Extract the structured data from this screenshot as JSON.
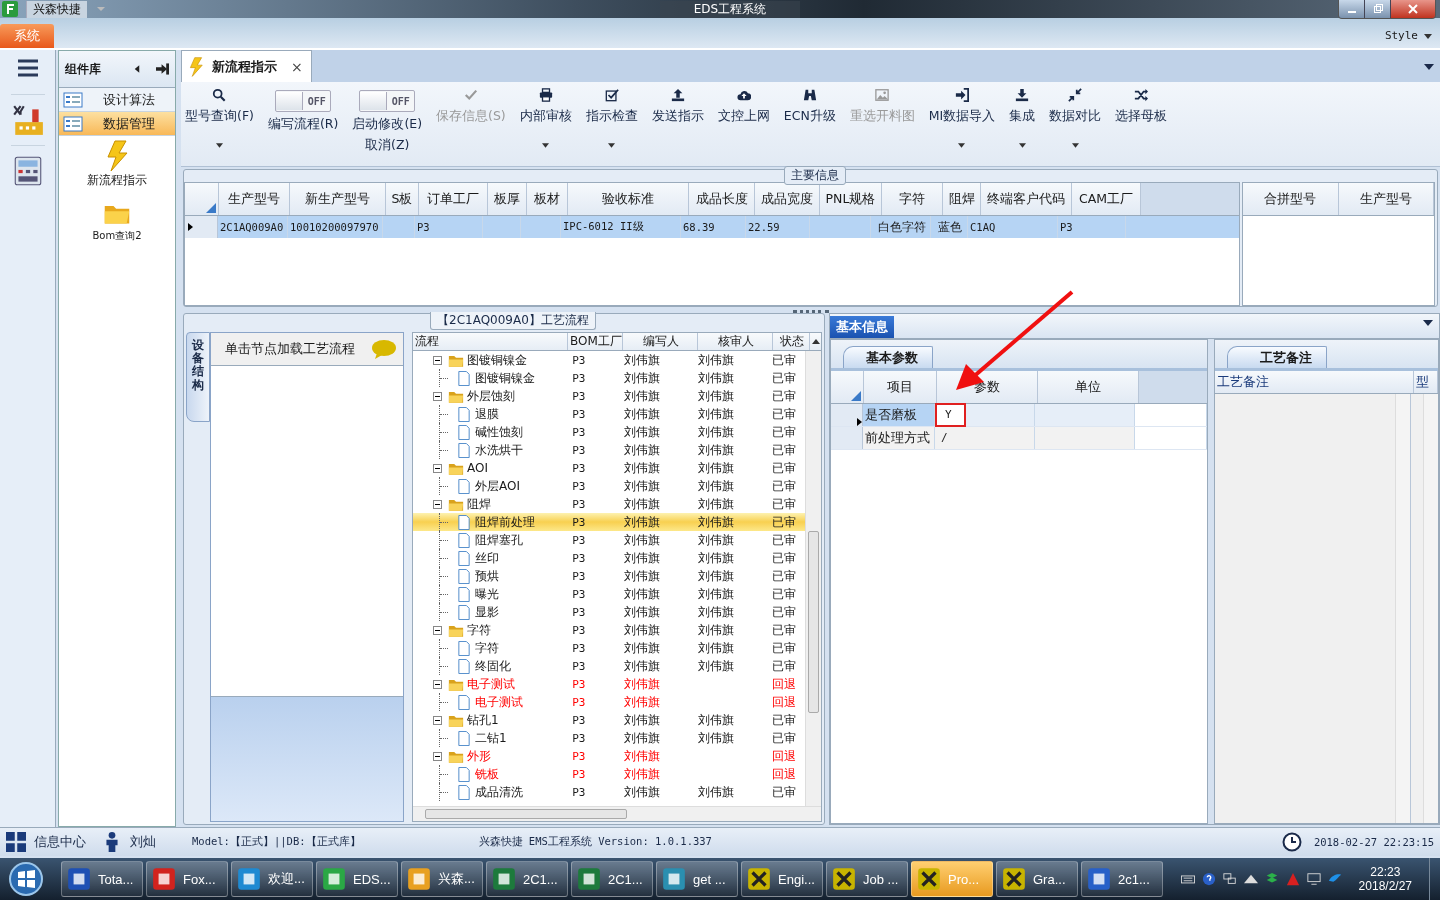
{
  "window": {
    "app_name": "兴森快捷",
    "title": "EDS工程系统"
  },
  "ribbon": {
    "tab": "系统",
    "style_label": "Style"
  },
  "component_panel": {
    "title": "组件库",
    "items": [
      {
        "label": "设计算法",
        "selected": false
      },
      {
        "label": "数据管理",
        "selected": true
      }
    ],
    "shortcuts": [
      {
        "label": "新流程指示",
        "kind": "bolt"
      },
      {
        "label": "Bom查询2",
        "kind": "folder"
      }
    ]
  },
  "document_tab": {
    "label": "新流程指示",
    "close": "×"
  },
  "toolbar": [
    {
      "kind": "search",
      "label": "型号查询(F)",
      "disabled": false,
      "dropdown": true
    },
    {
      "kind": "toggle",
      "switch_text": "OFF",
      "on": false,
      "label": "编写流程(R)"
    },
    {
      "kind": "toggle",
      "switch_text": "OFF",
      "on": false,
      "label": "启动修改(E)",
      "label2": "取消(Z)"
    },
    {
      "kind": "check",
      "label": "保存信息(S)",
      "disabled": true,
      "dropdown": false
    },
    {
      "kind": "printer",
      "label": "内部审核",
      "disabled": false,
      "dropdown": true
    },
    {
      "kind": "checkbox",
      "label": "指示检查",
      "disabled": false,
      "dropdown": true
    },
    {
      "kind": "upload",
      "label": "发送指示",
      "disabled": false,
      "dropdown": false
    },
    {
      "kind": "cloud",
      "label": "文控上网",
      "disabled": false,
      "dropdown": false
    },
    {
      "kind": "binoculars",
      "label": "ECN升级",
      "disabled": false,
      "dropdown": false
    },
    {
      "kind": "image",
      "label": "重选开料图",
      "disabled": true,
      "dropdown": false
    },
    {
      "kind": "signin",
      "label": "MI数据导入",
      "disabled": false,
      "dropdown": true
    },
    {
      "kind": "download",
      "label": "集成",
      "disabled": false,
      "dropdown": true
    },
    {
      "kind": "compress",
      "label": "数据对比",
      "disabled": false,
      "dropdown": true
    },
    {
      "kind": "shuffle",
      "label": "选择母板",
      "disabled": false,
      "dropdown": false
    }
  ],
  "main_info": {
    "title": "主要信息",
    "columns": [
      "生产型号",
      "新生产型号",
      "S板",
      "订单工厂",
      "板厚",
      "板材",
      "验收标准",
      "成品长度",
      "成品宽度",
      "PNL规格",
      "字符",
      "阻焊",
      "终端客户代码",
      "CAM工厂"
    ],
    "rows": [
      {
        "selected": true,
        "cells": [
          "2C1AQ009A0",
          "10010200097970",
          null,
          "P3",
          null,
          null,
          "IPC-6012 II级",
          "68.39",
          "22.59",
          null,
          "白色字符",
          "蓝色",
          "C1AQ",
          "P3"
        ]
      }
    ],
    "side_columns": [
      "合拼型号",
      "生产型号"
    ]
  },
  "process": {
    "title": "【2C1AQ009A0】工艺流程",
    "side_tab": "设备结构",
    "hint": "单击节点加载工艺流程",
    "columns": [
      "流程",
      "BOM工厂",
      "编写人",
      "核审人",
      "状态"
    ],
    "tree": [
      {
        "label": "图镀铜镍金",
        "bom": "P3",
        "writer": "刘伟旗",
        "reviewer": "刘伟旗",
        "status": "已审",
        "returned": false,
        "selected": false,
        "expanded": true,
        "children": [
          {
            "label": "图镀铜镍金",
            "bom": "P3",
            "writer": "刘伟旗",
            "reviewer": "刘伟旗",
            "status": "已审",
            "returned": false,
            "selected": false
          }
        ]
      },
      {
        "label": "外层蚀刻",
        "bom": "P3",
        "writer": "刘伟旗",
        "reviewer": "刘伟旗",
        "status": "已审",
        "returned": false,
        "selected": false,
        "expanded": true,
        "children": [
          {
            "label": "退膜",
            "bom": "P3",
            "writer": "刘伟旗",
            "reviewer": "刘伟旗",
            "status": "已审",
            "returned": false,
            "selected": false
          },
          {
            "label": "碱性蚀刻",
            "bom": "P3",
            "writer": "刘伟旗",
            "reviewer": "刘伟旗",
            "status": "已审",
            "returned": false,
            "selected": false
          },
          {
            "label": "水洗烘干",
            "bom": "P3",
            "writer": "刘伟旗",
            "reviewer": "刘伟旗",
            "status": "已审",
            "returned": false,
            "selected": false
          }
        ]
      },
      {
        "label": "AOI",
        "bom": "P3",
        "writer": "刘伟旗",
        "reviewer": "刘伟旗",
        "status": "已审",
        "returned": false,
        "selected": false,
        "expanded": true,
        "children": [
          {
            "label": "外层AOI",
            "bom": "P3",
            "writer": "刘伟旗",
            "reviewer": "刘伟旗",
            "status": "已审",
            "returned": false,
            "selected": false
          }
        ]
      },
      {
        "label": "阻焊",
        "bom": "P3",
        "writer": "刘伟旗",
        "reviewer": "刘伟旗",
        "status": "已审",
        "returned": false,
        "selected": false,
        "expanded": true,
        "children": [
          {
            "label": "阻焊前处理",
            "bom": "P3",
            "writer": "刘伟旗",
            "reviewer": "刘伟旗",
            "status": "已审",
            "returned": false,
            "selected": true
          },
          {
            "label": "阻焊塞孔",
            "bom": "P3",
            "writer": "刘伟旗",
            "reviewer": "刘伟旗",
            "status": "已审",
            "returned": false,
            "selected": false
          },
          {
            "label": "丝印",
            "bom": "P3",
            "writer": "刘伟旗",
            "reviewer": "刘伟旗",
            "status": "已审",
            "returned": false,
            "selected": false
          },
          {
            "label": "预烘",
            "bom": "P3",
            "writer": "刘伟旗",
            "reviewer": "刘伟旗",
            "status": "已审",
            "returned": false,
            "selected": false
          },
          {
            "label": "曝光",
            "bom": "P3",
            "writer": "刘伟旗",
            "reviewer": "刘伟旗",
            "status": "已审",
            "returned": false,
            "selected": false
          },
          {
            "label": "显影",
            "bom": "P3",
            "writer": "刘伟旗",
            "reviewer": "刘伟旗",
            "status": "已审",
            "returned": false,
            "selected": false
          }
        ]
      },
      {
        "label": "字符",
        "bom": "P3",
        "writer": "刘伟旗",
        "reviewer": "刘伟旗",
        "status": "已审",
        "returned": false,
        "selected": false,
        "expanded": true,
        "children": [
          {
            "label": "字符",
            "bom": "P3",
            "writer": "刘伟旗",
            "reviewer": "刘伟旗",
            "status": "已审",
            "returned": false,
            "selected": false
          },
          {
            "label": "终固化",
            "bom": "P3",
            "writer": "刘伟旗",
            "reviewer": "刘伟旗",
            "status": "已审",
            "returned": false,
            "selected": false
          }
        ]
      },
      {
        "label": "电子测试",
        "bom": "P3",
        "writer": "刘伟旗",
        "status": "回退",
        "returned": true,
        "selected": false,
        "expanded": true,
        "children": [
          {
            "label": "电子测试",
            "bom": "P3",
            "writer": "刘伟旗",
            "status": "回退",
            "returned": true,
            "selected": false
          }
        ]
      },
      {
        "label": "钻孔1",
        "bom": "P3",
        "writer": "刘伟旗",
        "reviewer": "刘伟旗",
        "status": "已审",
        "returned": false,
        "selected": false,
        "expanded": true,
        "children": [
          {
            "label": "二钻1",
            "bom": "P3",
            "writer": "刘伟旗",
            "reviewer": "刘伟旗",
            "status": "已审",
            "returned": false,
            "selected": false
          }
        ]
      },
      {
        "label": "外形",
        "bom": "P3",
        "writer": "刘伟旗",
        "status": "回退",
        "returned": true,
        "selected": false,
        "expanded": true,
        "children": [
          {
            "label": "铣板",
            "bom": "P3",
            "writer": "刘伟旗",
            "status": "回退",
            "returned": true,
            "selected": false
          },
          {
            "label": "成品清洗",
            "bom": "P3",
            "writer": "刘伟旗",
            "reviewer": "刘伟旗",
            "status": "已审",
            "returned": false,
            "selected": false
          }
        ]
      }
    ]
  },
  "basic_info": {
    "tab": "基本信息",
    "params": {
      "tab": "基本参数",
      "columns": [
        "项目",
        "参数",
        "单位"
      ],
      "rows": [
        {
          "item": "是否磨板",
          "value": "Y",
          "selected": true,
          "highlighted": true
        },
        {
          "item": "前处理方式",
          "value": "/",
          "selected": false,
          "highlighted": false
        }
      ]
    },
    "notes": {
      "tab": "工艺备注",
      "columns": [
        "工艺备注",
        "型"
      ]
    }
  },
  "status_bar": {
    "info_center": "信息中心",
    "user": "刘灿",
    "model": "Model:【正式】||DB:【正式库】",
    "version": "兴森快捷 EMS工程系统 Version: 1.0.1.337",
    "datetime": "2018-02-27 22:23:15"
  },
  "taskbar": {
    "items": [
      {
        "label": "Tota...",
        "kind": "floppy",
        "selected": false
      },
      {
        "label": "Fox...",
        "kind": "fox",
        "selected": false
      },
      {
        "label": "欢迎...",
        "kind": "ie",
        "selected": false
      },
      {
        "label": "EDS...",
        "kind": "eds",
        "selected": false
      },
      {
        "label": "兴森...",
        "kind": "shell",
        "selected": false
      },
      {
        "label": "2C1...",
        "kind": "excel",
        "selected": false
      },
      {
        "label": "2C1...",
        "kind": "excel",
        "selected": false
      },
      {
        "label": "get ...",
        "kind": "ball",
        "selected": false
      },
      {
        "label": "Engi...",
        "kind": "xwin",
        "selected": false
      },
      {
        "label": "Job ...",
        "kind": "xwin",
        "selected": false
      },
      {
        "label": "Pro...",
        "kind": "xwin",
        "selected": true
      },
      {
        "label": "Gra...",
        "kind": "xwin",
        "selected": false
      },
      {
        "label": "2c1...",
        "kind": "doc",
        "selected": false
      }
    ],
    "time": "22:23",
    "date": "2018/2/27"
  }
}
